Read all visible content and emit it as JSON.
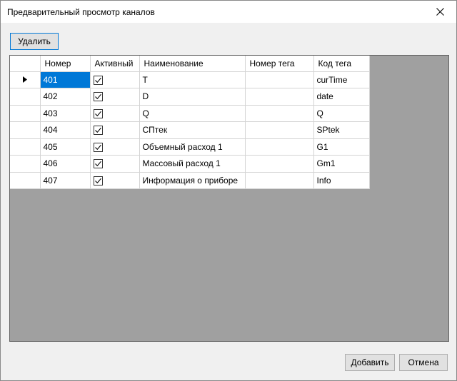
{
  "window": {
    "title": "Предварительный просмотр каналов"
  },
  "toolbar": {
    "delete_label": "Удалить"
  },
  "grid": {
    "columns": [
      "Номер",
      "Активный",
      "Наименование",
      "Номер тега",
      "Код тега"
    ],
    "rows": [
      {
        "number": "401",
        "active": true,
        "name": "T",
        "tag_number": "",
        "tag_code": "curTime"
      },
      {
        "number": "402",
        "active": true,
        "name": "D",
        "tag_number": "",
        "tag_code": "date"
      },
      {
        "number": "403",
        "active": true,
        "name": "Q",
        "tag_number": "",
        "tag_code": "Q"
      },
      {
        "number": "404",
        "active": true,
        "name": "СПтек",
        "tag_number": "",
        "tag_code": "SPtek"
      },
      {
        "number": "405",
        "active": true,
        "name": "Объемный расход 1",
        "tag_number": "",
        "tag_code": "G1"
      },
      {
        "number": "406",
        "active": true,
        "name": "Массовый расход 1",
        "tag_number": "",
        "tag_code": "Gm1"
      },
      {
        "number": "407",
        "active": true,
        "name": "Информация о приборе",
        "tag_number": "",
        "tag_code": "Info"
      }
    ]
  },
  "footer": {
    "add_label": "Добавить",
    "cancel_label": "Отмена"
  },
  "colors": {
    "selection": "#0078d7",
    "grid_background": "#a0a0a0"
  }
}
